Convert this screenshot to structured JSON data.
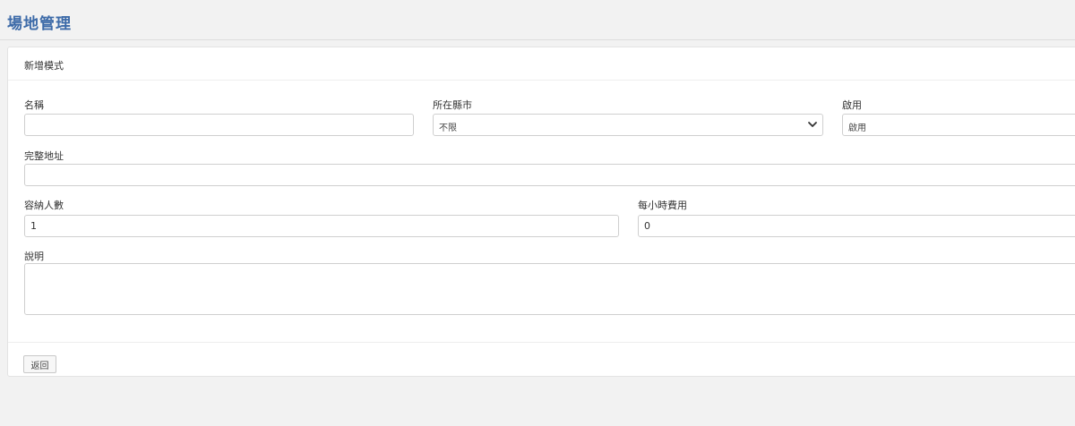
{
  "page": {
    "title": "場地管理"
  },
  "panel": {
    "heading": "新增模式"
  },
  "fields": {
    "name": {
      "label": "名稱",
      "value": ""
    },
    "city": {
      "label": "所在縣市",
      "value": "不限",
      "options": [
        "不限"
      ]
    },
    "enabled": {
      "label": "啟用",
      "value": "啟用"
    },
    "address": {
      "label": "完整地址",
      "value": ""
    },
    "capacity": {
      "label": "容納人數",
      "value": "1"
    },
    "hourly_fee": {
      "label": "每小時費用",
      "value": "0"
    },
    "description": {
      "label": "說明",
      "value": ""
    }
  },
  "footer": {
    "back_label": "返回"
  },
  "colors": {
    "title": "#3c6aa8",
    "background": "#f2f2f2",
    "panel": "#ffffff",
    "border": "#cfcfcf"
  }
}
